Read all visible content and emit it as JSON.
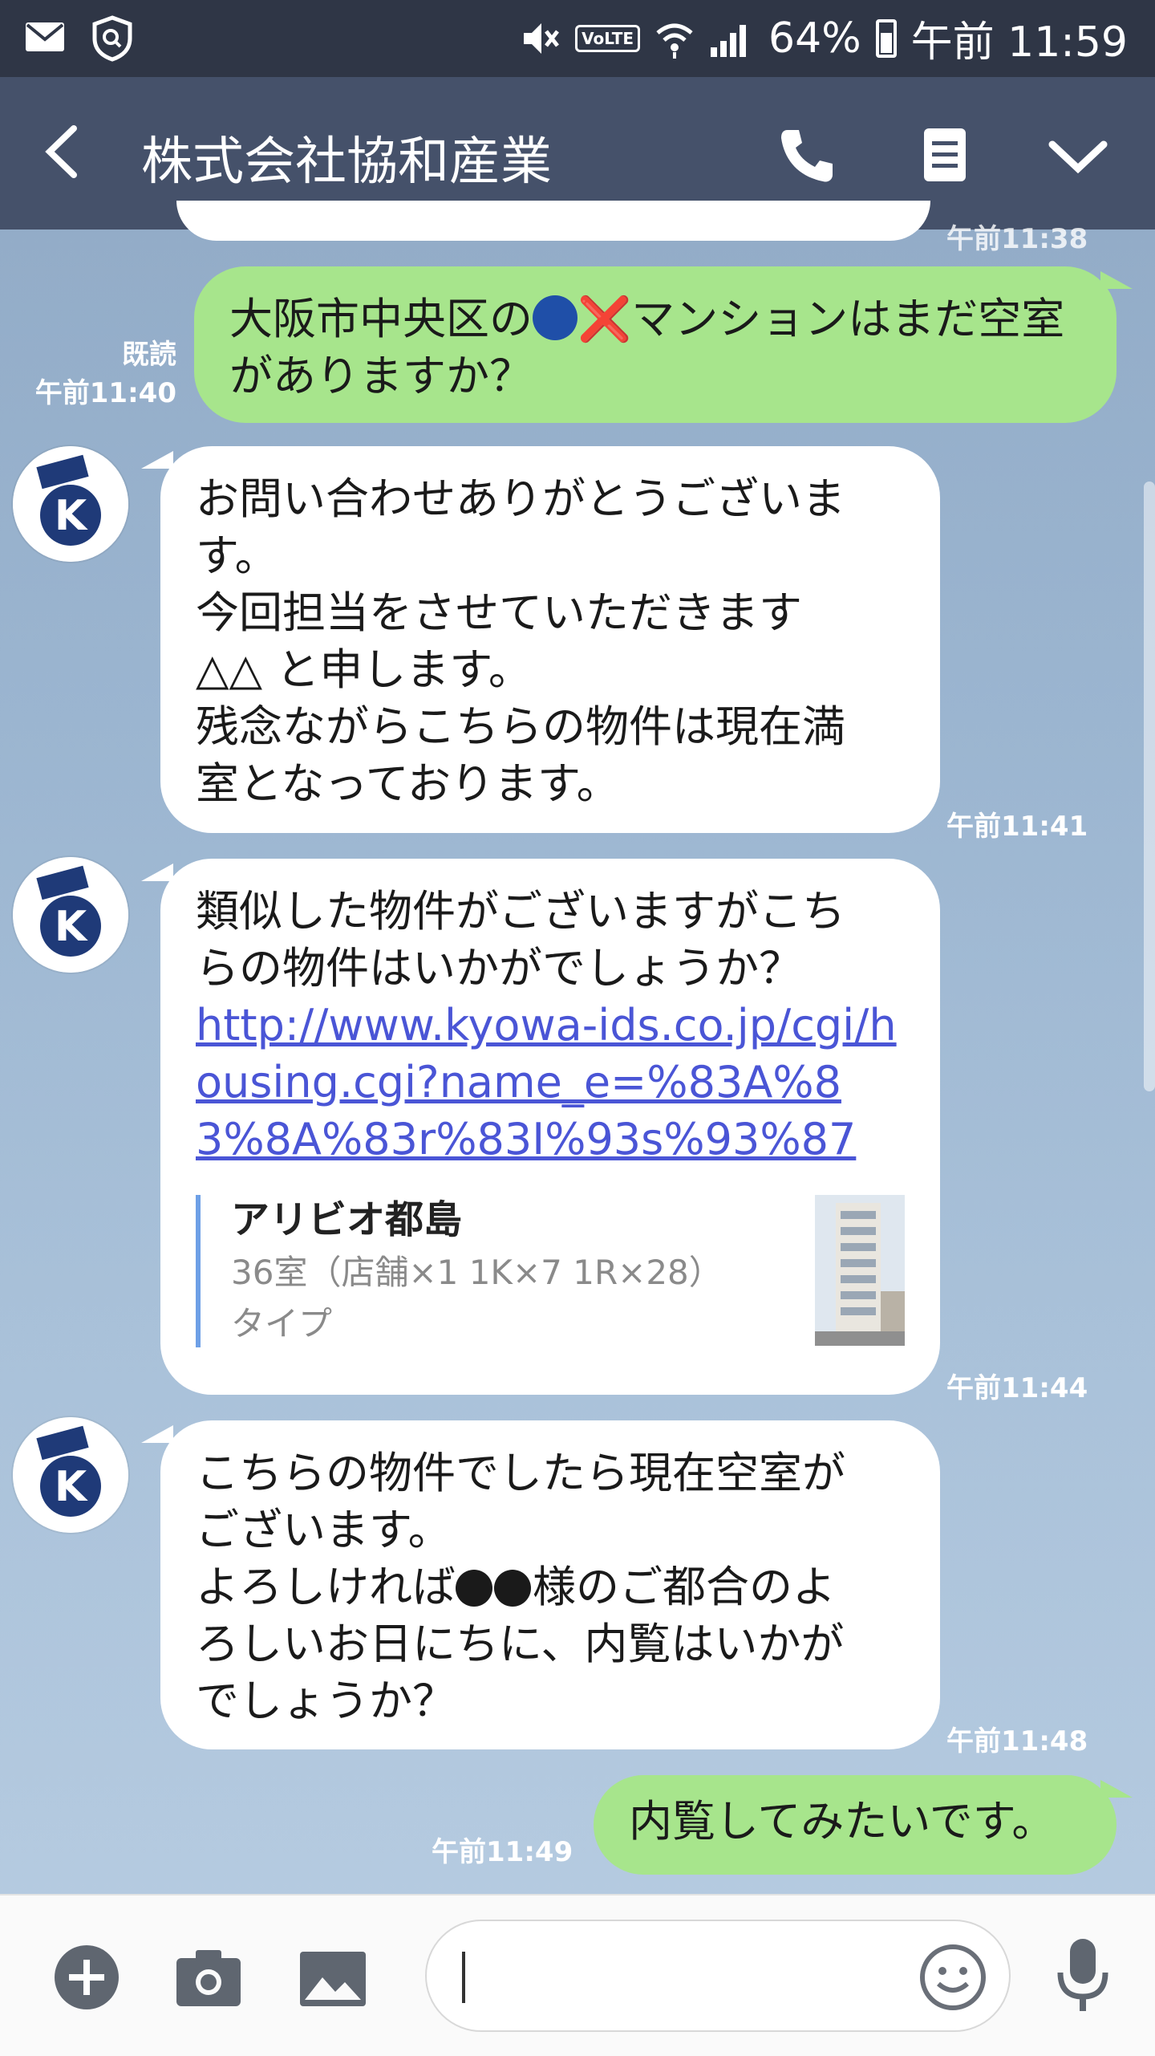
{
  "status_bar": {
    "battery": "64%",
    "time": "午前 11:59",
    "volte": "VoLTE"
  },
  "header": {
    "title": "株式会社協和産業"
  },
  "partial_message": {
    "time": "午前11:38"
  },
  "messages": [
    {
      "direction": "out",
      "read_label": "既読",
      "time": "午前11:40",
      "text_a": "大阪市中央区の",
      "text_b": "マンションはまだ空室がありますか？",
      "cross": "❌"
    },
    {
      "direction": "in",
      "time": "午前11:41",
      "lines": [
        "お問い合わせありがとうございま",
        "す。",
        "今回担当をさせていただきます",
        "△△ と申します。",
        "残念ながらこちらの物件は現在満",
        "室となっております。"
      ]
    },
    {
      "direction": "in",
      "time": "午前11:44",
      "lines": [
        "類似した物件がございますがこち",
        "らの物件はいかがでしょうか？"
      ],
      "link": "http://www.kyowa-ids.co.jp/cgi/housing.cgi?name_e=%83A%83%8A%83r%83I%93s%93%87",
      "preview": {
        "title": "アリビオ都島",
        "desc_line1": "36室（店舗×1 1K×7 1R×28）",
        "desc_line2": "タイプ"
      }
    },
    {
      "direction": "in",
      "time": "午前11:48",
      "line1": "こちらの物件でしたら現在空室が",
      "line2": "ございます。",
      "line3_a": "よろしければ",
      "line3_b": "様のご都合のよ",
      "line4": "ろしいお日にちに、内覧はいかが",
      "line5": "でしょうか？"
    },
    {
      "direction": "out",
      "time": "午前11:49",
      "text": "内覧してみたいです。"
    }
  ],
  "colors": {
    "outgoing_bubble": "#a7e58c",
    "incoming_bubble": "#ffffff",
    "header": "#45516a",
    "status_bar": "#2f3646",
    "link": "#4a55d6"
  }
}
